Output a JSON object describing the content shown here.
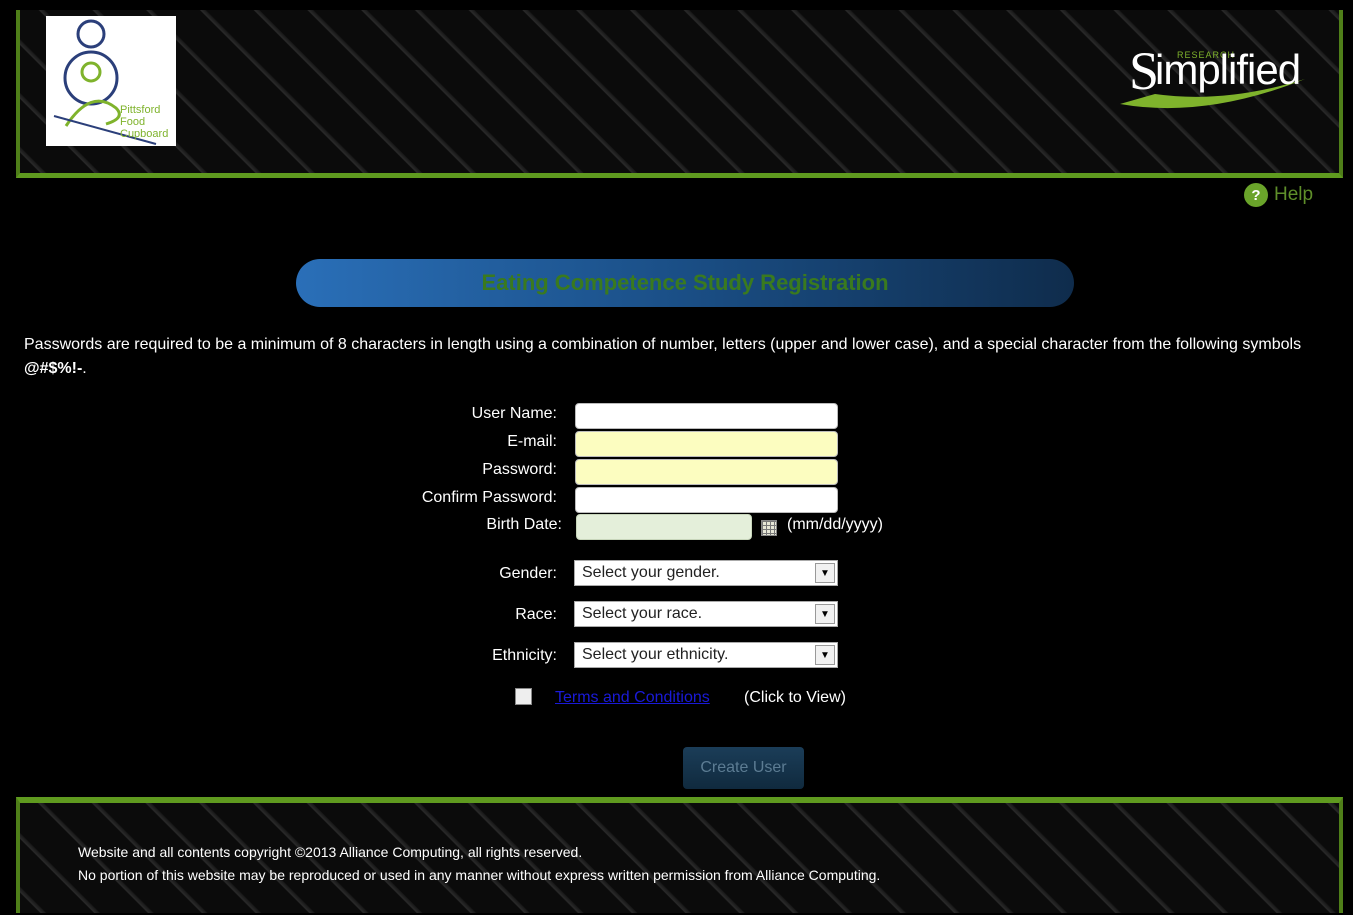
{
  "header": {
    "left_logo": {
      "text_lines": [
        "Pittsford",
        "Food",
        "Cupboard"
      ]
    },
    "right_logo": {
      "small_text": "RESEARCH",
      "word": "implified",
      "initial": "S"
    }
  },
  "help": {
    "label": "Help",
    "icon": "question-icon",
    "color": "#5f8f2a"
  },
  "banner": {
    "title": "Eating Competence Study Registration"
  },
  "notice": {
    "text": "Passwords are required to be a minimum of 8 characters in length using a combination of number, letters (upper and lower case), and a special character from the following symbols ",
    "symbols": "@#$%!-",
    "end": "."
  },
  "form": {
    "username_label": "User Name:",
    "email_label": "E-mail:",
    "password_label": "Password:",
    "confirm_label": "Confirm Password:",
    "birthdate_label": "Birth Date:",
    "birthdate_hint": "(mm/dd/yyyy)",
    "gender_label": "Gender:",
    "gender_value": "Select your gender.",
    "race_label": "Race:",
    "race_value": "Select your race.",
    "ethnicity_label": "Ethnicity:",
    "ethnicity_value": "Select your ethnicity.",
    "terms_link": "Terms and Conditions",
    "terms_hint": "(Click to View)",
    "submit_label": "Create User"
  },
  "footer": {
    "line1": "Website and all contents copyright ©2013 Alliance Computing, all rights reserved.",
    "line2": "No portion of this website may be reproduced or used in any manner without express written permission from Alliance Computing."
  },
  "colors": {
    "accent_green": "#5f9a1f",
    "banner_blue": "#2a6fb8",
    "required_yellow": "#fcfdc0"
  }
}
